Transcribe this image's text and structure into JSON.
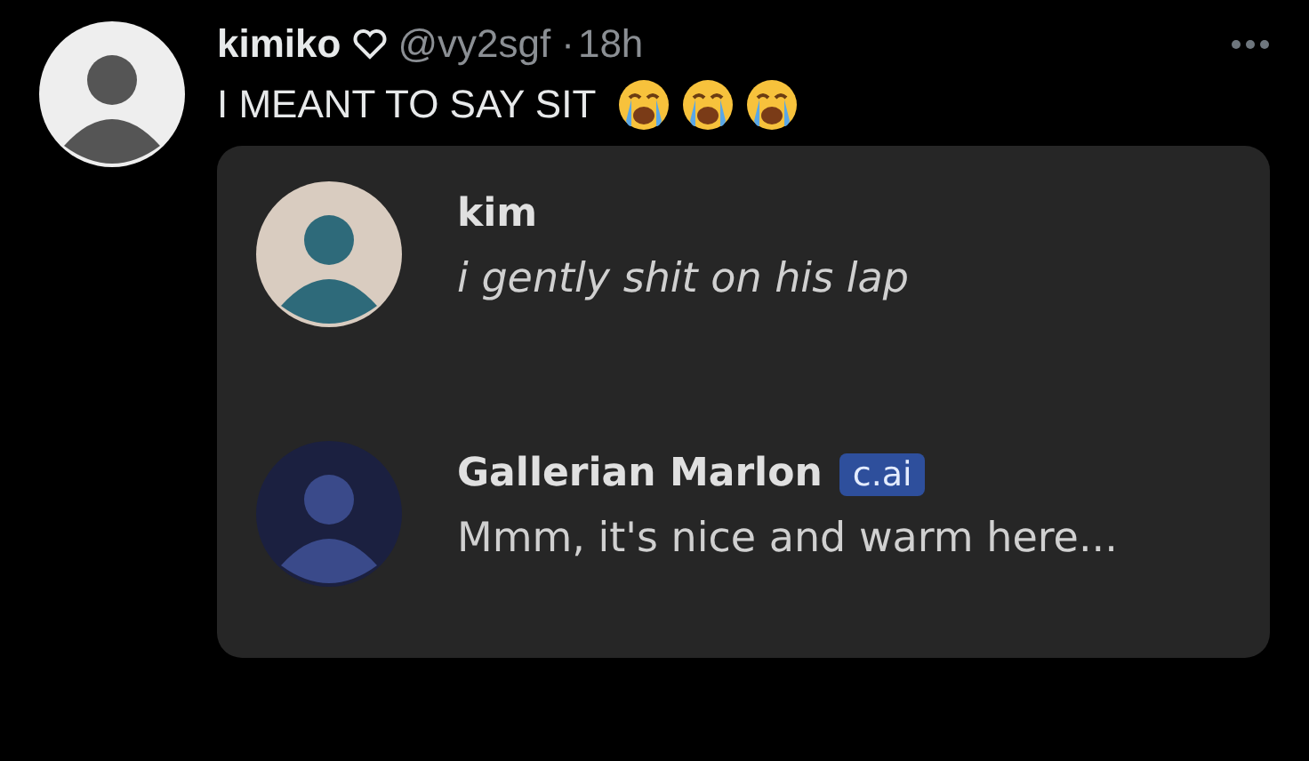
{
  "post": {
    "author": {
      "display_name": "kimiko",
      "handle": "@vy2sgf",
      "separator": "·",
      "time": "18h"
    },
    "text": "I MEANT TO SAY SIT",
    "emojis": [
      {
        "kind": "crying"
      },
      {
        "kind": "crying"
      },
      {
        "kind": "crying"
      }
    ],
    "chat": [
      {
        "kind": "user",
        "name": "kim",
        "text": "i gently shit on his lap"
      },
      {
        "kind": "bot",
        "name": "Gallerian Marlon",
        "badge": "c.ai",
        "text": "Mmm, it's nice and warm here..."
      }
    ]
  }
}
